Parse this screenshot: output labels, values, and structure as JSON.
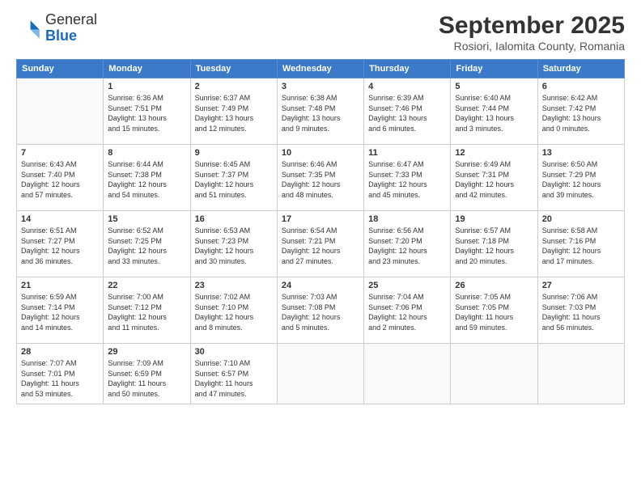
{
  "header": {
    "logo_line1": "General",
    "logo_line2": "Blue",
    "month": "September 2025",
    "location": "Rosiori, Ialomita County, Romania"
  },
  "weekdays": [
    "Sunday",
    "Monday",
    "Tuesday",
    "Wednesday",
    "Thursday",
    "Friday",
    "Saturday"
  ],
  "weeks": [
    [
      {
        "day": "",
        "info": ""
      },
      {
        "day": "1",
        "info": "Sunrise: 6:36 AM\nSunset: 7:51 PM\nDaylight: 13 hours\nand 15 minutes."
      },
      {
        "day": "2",
        "info": "Sunrise: 6:37 AM\nSunset: 7:49 PM\nDaylight: 13 hours\nand 12 minutes."
      },
      {
        "day": "3",
        "info": "Sunrise: 6:38 AM\nSunset: 7:48 PM\nDaylight: 13 hours\nand 9 minutes."
      },
      {
        "day": "4",
        "info": "Sunrise: 6:39 AM\nSunset: 7:46 PM\nDaylight: 13 hours\nand 6 minutes."
      },
      {
        "day": "5",
        "info": "Sunrise: 6:40 AM\nSunset: 7:44 PM\nDaylight: 13 hours\nand 3 minutes."
      },
      {
        "day": "6",
        "info": "Sunrise: 6:42 AM\nSunset: 7:42 PM\nDaylight: 13 hours\nand 0 minutes."
      }
    ],
    [
      {
        "day": "7",
        "info": "Sunrise: 6:43 AM\nSunset: 7:40 PM\nDaylight: 12 hours\nand 57 minutes."
      },
      {
        "day": "8",
        "info": "Sunrise: 6:44 AM\nSunset: 7:38 PM\nDaylight: 12 hours\nand 54 minutes."
      },
      {
        "day": "9",
        "info": "Sunrise: 6:45 AM\nSunset: 7:37 PM\nDaylight: 12 hours\nand 51 minutes."
      },
      {
        "day": "10",
        "info": "Sunrise: 6:46 AM\nSunset: 7:35 PM\nDaylight: 12 hours\nand 48 minutes."
      },
      {
        "day": "11",
        "info": "Sunrise: 6:47 AM\nSunset: 7:33 PM\nDaylight: 12 hours\nand 45 minutes."
      },
      {
        "day": "12",
        "info": "Sunrise: 6:49 AM\nSunset: 7:31 PM\nDaylight: 12 hours\nand 42 minutes."
      },
      {
        "day": "13",
        "info": "Sunrise: 6:50 AM\nSunset: 7:29 PM\nDaylight: 12 hours\nand 39 minutes."
      }
    ],
    [
      {
        "day": "14",
        "info": "Sunrise: 6:51 AM\nSunset: 7:27 PM\nDaylight: 12 hours\nand 36 minutes."
      },
      {
        "day": "15",
        "info": "Sunrise: 6:52 AM\nSunset: 7:25 PM\nDaylight: 12 hours\nand 33 minutes."
      },
      {
        "day": "16",
        "info": "Sunrise: 6:53 AM\nSunset: 7:23 PM\nDaylight: 12 hours\nand 30 minutes."
      },
      {
        "day": "17",
        "info": "Sunrise: 6:54 AM\nSunset: 7:21 PM\nDaylight: 12 hours\nand 27 minutes."
      },
      {
        "day": "18",
        "info": "Sunrise: 6:56 AM\nSunset: 7:20 PM\nDaylight: 12 hours\nand 23 minutes."
      },
      {
        "day": "19",
        "info": "Sunrise: 6:57 AM\nSunset: 7:18 PM\nDaylight: 12 hours\nand 20 minutes."
      },
      {
        "day": "20",
        "info": "Sunrise: 6:58 AM\nSunset: 7:16 PM\nDaylight: 12 hours\nand 17 minutes."
      }
    ],
    [
      {
        "day": "21",
        "info": "Sunrise: 6:59 AM\nSunset: 7:14 PM\nDaylight: 12 hours\nand 14 minutes."
      },
      {
        "day": "22",
        "info": "Sunrise: 7:00 AM\nSunset: 7:12 PM\nDaylight: 12 hours\nand 11 minutes."
      },
      {
        "day": "23",
        "info": "Sunrise: 7:02 AM\nSunset: 7:10 PM\nDaylight: 12 hours\nand 8 minutes."
      },
      {
        "day": "24",
        "info": "Sunrise: 7:03 AM\nSunset: 7:08 PM\nDaylight: 12 hours\nand 5 minutes."
      },
      {
        "day": "25",
        "info": "Sunrise: 7:04 AM\nSunset: 7:06 PM\nDaylight: 12 hours\nand 2 minutes."
      },
      {
        "day": "26",
        "info": "Sunrise: 7:05 AM\nSunset: 7:05 PM\nDaylight: 11 hours\nand 59 minutes."
      },
      {
        "day": "27",
        "info": "Sunrise: 7:06 AM\nSunset: 7:03 PM\nDaylight: 11 hours\nand 56 minutes."
      }
    ],
    [
      {
        "day": "28",
        "info": "Sunrise: 7:07 AM\nSunset: 7:01 PM\nDaylight: 11 hours\nand 53 minutes."
      },
      {
        "day": "29",
        "info": "Sunrise: 7:09 AM\nSunset: 6:59 PM\nDaylight: 11 hours\nand 50 minutes."
      },
      {
        "day": "30",
        "info": "Sunrise: 7:10 AM\nSunset: 6:57 PM\nDaylight: 11 hours\nand 47 minutes."
      },
      {
        "day": "",
        "info": ""
      },
      {
        "day": "",
        "info": ""
      },
      {
        "day": "",
        "info": ""
      },
      {
        "day": "",
        "info": ""
      }
    ]
  ]
}
